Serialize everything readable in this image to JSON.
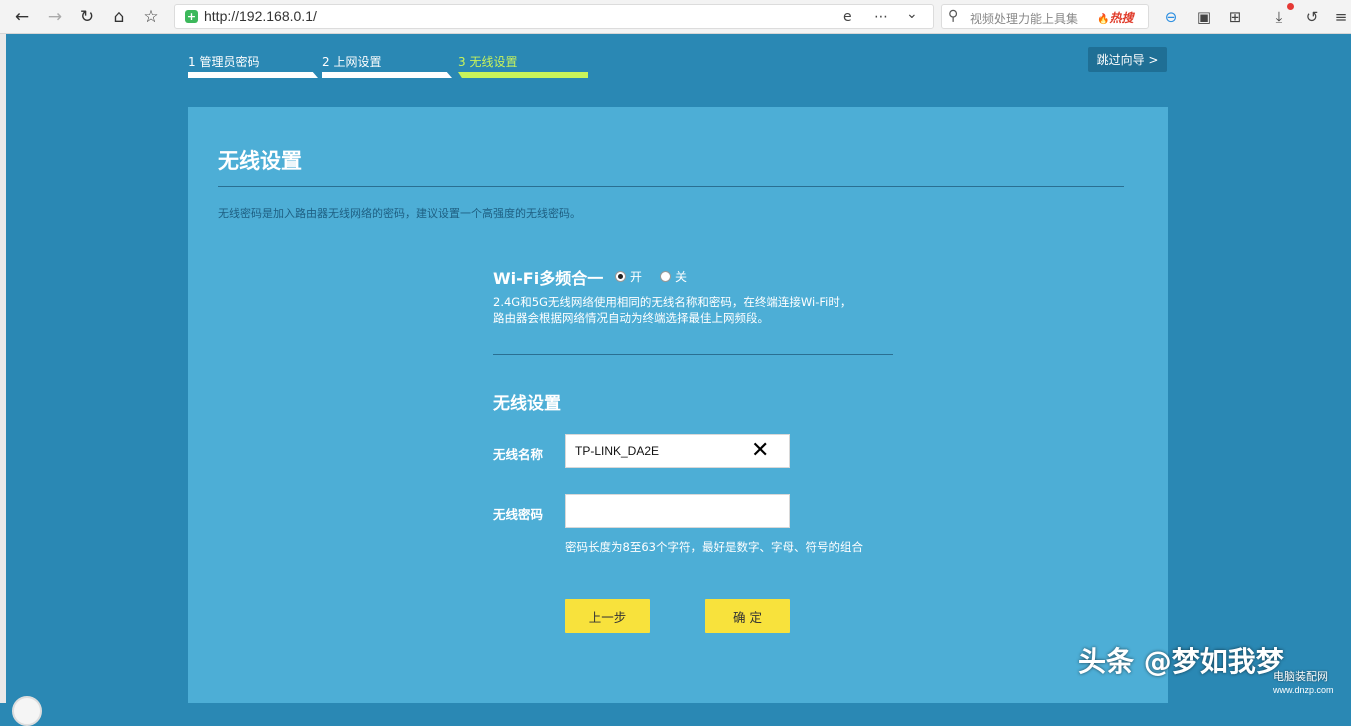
{
  "browser": {
    "url": "http://192.168.0.1/",
    "search_placeholder": "视频处理力能上具集",
    "hot_search_label": "热搜",
    "icons": {
      "back": "←",
      "forward": "→",
      "reload": "↻",
      "home": "⌂",
      "favorite": "☆",
      "compat": "e",
      "more": "⋯",
      "dropdown": "⌄",
      "search": "⚲",
      "hot": "🔥",
      "extension1": "⊖",
      "extension2": "▣",
      "apps": "⊞",
      "download": "⤓",
      "undo": "↺",
      "menu": "≡"
    }
  },
  "wizard": {
    "steps": [
      {
        "label": "1 管理员密码"
      },
      {
        "label": "2 上网设置"
      },
      {
        "label": "3 无线设置"
      }
    ],
    "skip_label": "跳过向导 >"
  },
  "panel": {
    "title": "无线设置",
    "description": "无线密码是加入路由器无线网络的密码，建议设置一个高强度的无线密码。",
    "wifi_merge": {
      "title": "Wi-Fi多频合一",
      "on_label": "开",
      "off_label": "关",
      "selected": "开",
      "desc_line1": "2.4G和5G无线网络使用相同的无线名称和密码，在终端连接Wi-Fi时，",
      "desc_line2": "路由器会根据网络情况自动为终端选择最佳上网频段。"
    },
    "wireless": {
      "title": "无线设置",
      "name_label": "无线名称",
      "name_value": "TP-LINK_DA2E",
      "password_label": "无线密码",
      "password_value": "",
      "password_hint": "密码长度为8至63个字符，最好是数字、字母、符号的组合"
    },
    "buttons": {
      "prev_label": "上一步",
      "confirm_label": "确 定"
    }
  },
  "watermark": {
    "text": "头条 @梦如我梦",
    "site_name": "电脑装配网",
    "site_url": "www.dnzp.com"
  },
  "colors": {
    "page_bg": "#2a88b4",
    "panel_bg": "#4daed6",
    "active_step": "#c9f35a",
    "button": "#f8e23c"
  }
}
